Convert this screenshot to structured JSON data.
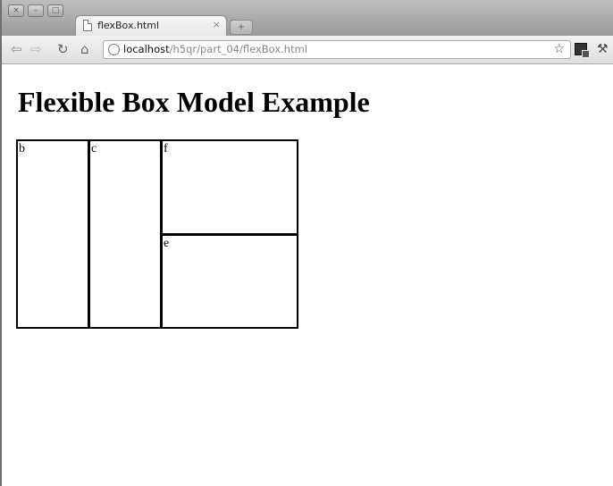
{
  "window": {
    "buttons": [
      "×",
      "–",
      "□"
    ]
  },
  "tab": {
    "title": "flexBox.html",
    "close": "×",
    "new_tab": "+"
  },
  "toolbar": {
    "back": "⇦",
    "forward": "⇨",
    "reload": "↻",
    "home": "⌂",
    "url_host": "localhost",
    "url_path": "/h5qr/part_04/flexBox.html",
    "star": "☆",
    "wrench": "⚒"
  },
  "page": {
    "title": "Flexible Box Model Example",
    "boxes": {
      "b": "b",
      "c": "c",
      "f": "f",
      "e": "e"
    }
  }
}
